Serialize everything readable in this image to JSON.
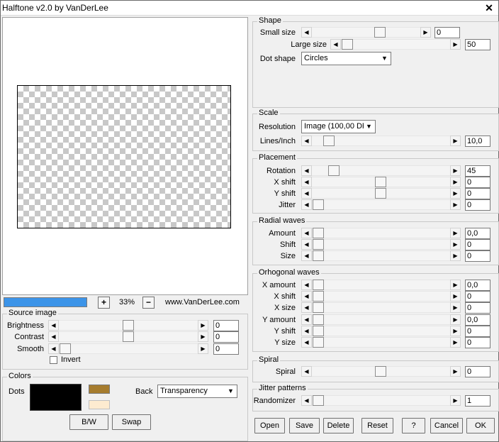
{
  "window": {
    "title": "Halftone v2.0 by VanDerLee",
    "close_glyph": "✕"
  },
  "zoom": {
    "minus": "−",
    "plus": "+",
    "value": "33%"
  },
  "progress": {
    "fraction": 1.0,
    "color": "#3c94e8"
  },
  "site": "www.VanDerLee.com",
  "arrows": {
    "left": "◀",
    "right": "▶",
    "down": "▼"
  },
  "source": {
    "title": "Source image",
    "brightness": {
      "label": "Brightness",
      "value": "0"
    },
    "contrast": {
      "label": "Contrast",
      "value": "0"
    },
    "smooth": {
      "label": "Smooth",
      "value": "0"
    },
    "invert": {
      "label": "Invert",
      "checked": false
    }
  },
  "colors": {
    "title": "Colors",
    "dots_label": "Dots",
    "dots_color": "#000000",
    "swatch_a": "#a67c2e",
    "swatch_b": "#fdebd0",
    "back_label": "Back",
    "back_value": "Transparency",
    "bw_button": "B/W",
    "swap_button": "Swap"
  },
  "shape": {
    "title": "Shape",
    "small_size": {
      "label": "Small size",
      "value": "0"
    },
    "large_size": {
      "label": "Large size",
      "value": "50"
    },
    "dot_shape": {
      "label": "Dot shape",
      "value": "Circles"
    }
  },
  "scale": {
    "title": "Scale",
    "resolution": {
      "label": "Resolution",
      "value": "Image (100,00 DF"
    },
    "lines_inch": {
      "label": "Lines/Inch",
      "value": "10,0"
    }
  },
  "placement": {
    "title": "Placement",
    "rotation": {
      "label": "Rotation",
      "value": "45"
    },
    "x_shift": {
      "label": "X shift",
      "value": "0"
    },
    "y_shift": {
      "label": "Y shift",
      "value": "0"
    },
    "jitter": {
      "label": "Jitter",
      "value": "0"
    }
  },
  "radial": {
    "title": "Radial waves",
    "amount": {
      "label": "Amount",
      "value": "0,0"
    },
    "shift": {
      "label": "Shift",
      "value": "0"
    },
    "size": {
      "label": "Size",
      "value": "0"
    }
  },
  "ortho": {
    "title": "Orhogonal waves",
    "x_amount": {
      "label": "X amount",
      "value": "0,0"
    },
    "x_shift": {
      "label": "X shift",
      "value": "0"
    },
    "x_size": {
      "label": "X size",
      "value": "0"
    },
    "y_amount": {
      "label": "Y amount",
      "value": "0,0"
    },
    "y_shift": {
      "label": "Y shift",
      "value": "0"
    },
    "y_size": {
      "label": "Y size",
      "value": "0"
    }
  },
  "spiral": {
    "title": "Spiral",
    "spiral": {
      "label": "Spiral",
      "value": "0"
    }
  },
  "jitter_patterns": {
    "title": "Jitter patterns",
    "randomizer": {
      "label": "Randomizer",
      "value": "1"
    }
  },
  "buttons": {
    "open": "Open",
    "save": "Save",
    "delete": "Delete",
    "reset": "Reset",
    "help": "?",
    "cancel": "Cancel",
    "ok": "OK"
  }
}
